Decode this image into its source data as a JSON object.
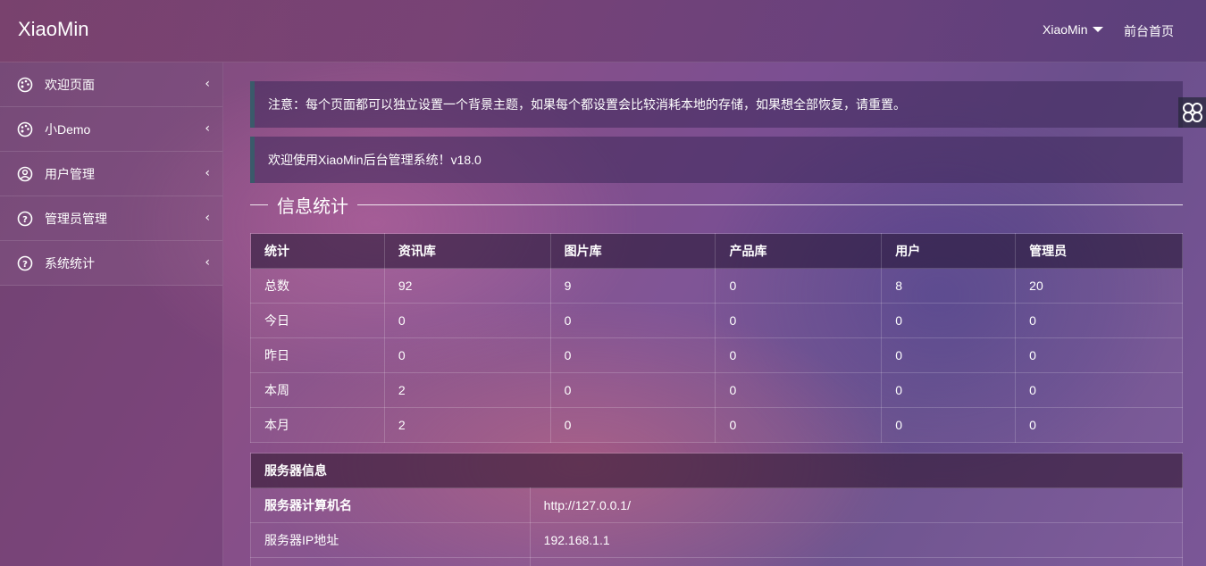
{
  "header": {
    "logo": "XiaoMin",
    "user": "XiaoMin",
    "home_link": "前台首页"
  },
  "sidebar": {
    "items": [
      {
        "label": "欢迎页面",
        "icon": "palette-icon"
      },
      {
        "label": "小Demo",
        "icon": "palette-icon"
      },
      {
        "label": "用户管理",
        "icon": "user-icon"
      },
      {
        "label": "管理员管理",
        "icon": "help-icon"
      },
      {
        "label": "系统统计",
        "icon": "help-icon"
      }
    ]
  },
  "notices": {
    "notice1": "注意：每个页面都可以独立设置一个背景主题，如果每个都设置会比较消耗本地的存储，如果想全部恢复，请重置。",
    "notice2": "欢迎使用XiaoMin后台管理系统！v18.0"
  },
  "section": {
    "title": "信息统计"
  },
  "stats_table": {
    "headers": [
      "统计",
      "资讯库",
      "图片库",
      "产品库",
      "用户",
      "管理员"
    ],
    "rows": [
      [
        "总数",
        "92",
        "9",
        "0",
        "8",
        "20"
      ],
      [
        "今日",
        "0",
        "0",
        "0",
        "0",
        "0"
      ],
      [
        "昨日",
        "0",
        "0",
        "0",
        "0",
        "0"
      ],
      [
        "本周",
        "2",
        "0",
        "0",
        "0",
        "0"
      ],
      [
        "本月",
        "2",
        "0",
        "0",
        "0",
        "0"
      ]
    ]
  },
  "server_table": {
    "title": "服务器信息",
    "rows": [
      [
        "服务器计算机名",
        "http://127.0.0.1/"
      ],
      [
        "服务器IP地址",
        "192.168.1.1"
      ]
    ]
  }
}
